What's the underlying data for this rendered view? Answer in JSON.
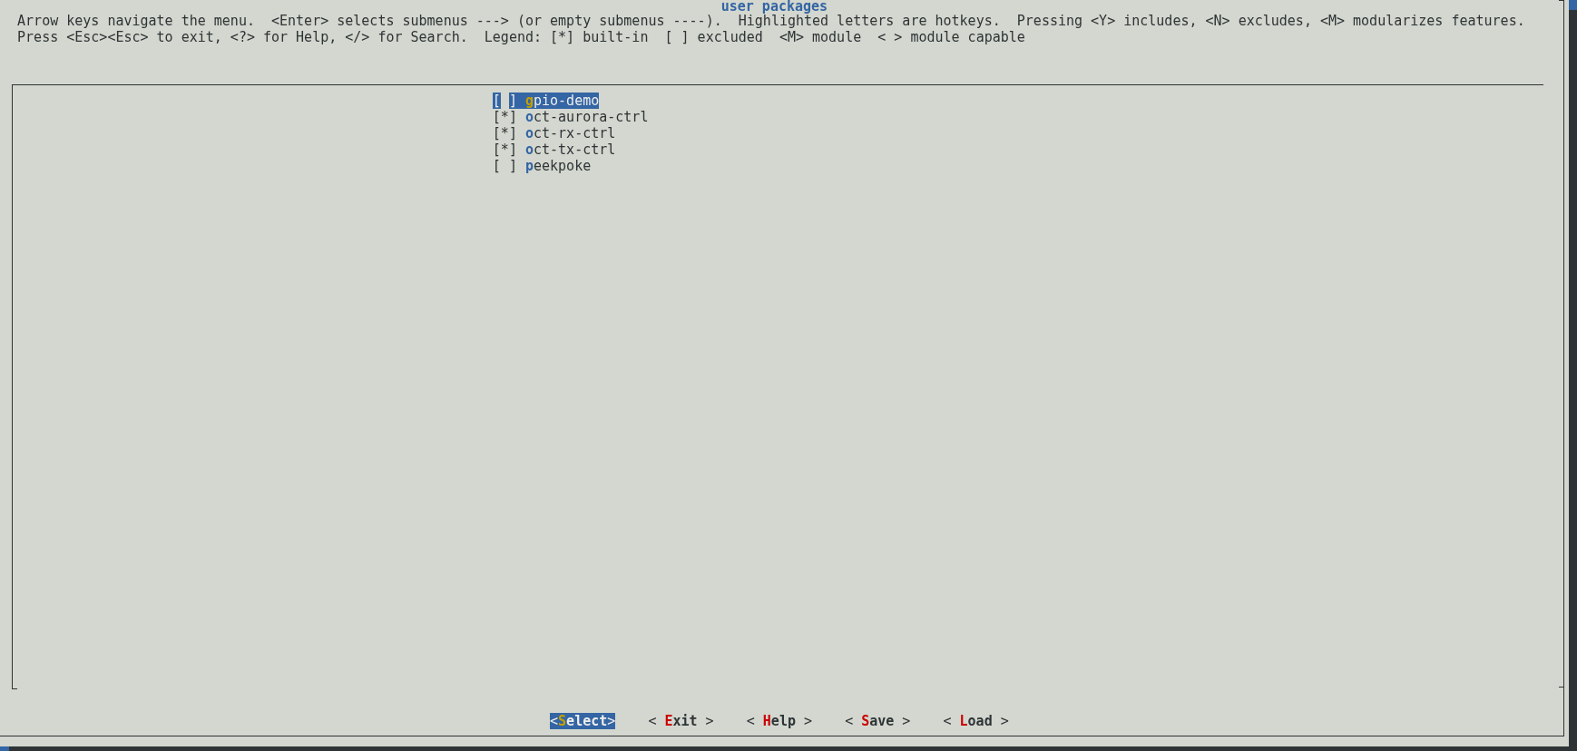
{
  "dialog": {
    "title": "user packages",
    "help_lines": [
      "Arrow keys navigate the menu.  <Enter> selects submenus ---> (or empty submenus ----).  Highlighted letters are hotkeys.  Pressing <Y> includes, <N> excludes, <M> modularizes features.",
      "Press <Esc><Esc> to exit, <?> for Help, </> for Search.  Legend: [*] built-in  [ ] excluded  <M> module  < > module capable"
    ]
  },
  "menu": {
    "items": [
      {
        "box": "[ ]",
        "label": "gpio-demo",
        "selected": true
      },
      {
        "box": "[*]",
        "label": "oct-aurora-ctrl",
        "selected": false
      },
      {
        "box": "[*]",
        "label": "oct-rx-ctrl",
        "selected": false
      },
      {
        "box": "[*]",
        "label": "oct-tx-ctrl",
        "selected": false
      },
      {
        "box": "[ ]",
        "label": "peekpoke",
        "selected": false
      }
    ]
  },
  "buttons": [
    {
      "label": "<Select>",
      "selected": true
    },
    {
      "label": "< Exit >",
      "selected": false
    },
    {
      "label": "< Help >",
      "selected": false
    },
    {
      "label": "< Save >",
      "selected": false
    },
    {
      "label": "< Load >",
      "selected": false
    }
  ]
}
